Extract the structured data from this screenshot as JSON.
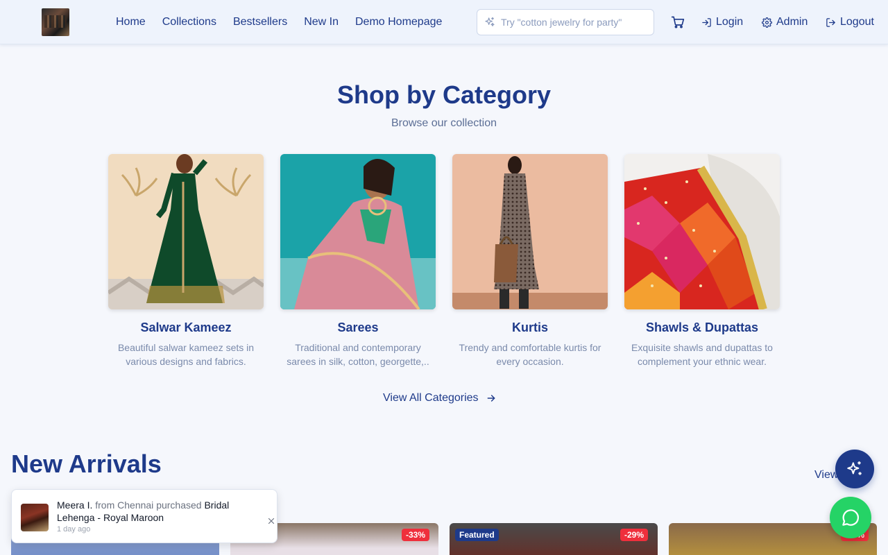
{
  "header": {
    "nav": [
      "Home",
      "Collections",
      "Bestsellers",
      "New In",
      "Demo Homepage"
    ],
    "search_placeholder": "Try \"cotton jewelry for party\"",
    "login": "Login",
    "admin": "Admin",
    "logout": "Logout"
  },
  "categories": {
    "title": "Shop by Category",
    "subtitle": "Browse our collection",
    "items": [
      {
        "name": "Salwar Kameez",
        "desc": "Beautiful salwar kameez sets in various designs and fabrics."
      },
      {
        "name": "Sarees",
        "desc": "Traditional and contemporary sarees in silk, cotton, georgette,.."
      },
      {
        "name": "Kurtis",
        "desc": "Trendy and comfortable kurtis for every occasion."
      },
      {
        "name": "Shawls & Dupattas",
        "desc": "Exquisite shawls and dupattas to complement your ethnic wear."
      }
    ],
    "view_all": "View All Categories"
  },
  "new_arrivals": {
    "title": "New Arrivals",
    "view_all": "View All",
    "badges": {
      "p2": "-33%",
      "p3_featured": "Featured",
      "p3": "-29%",
      "p4": "-43%"
    }
  },
  "toast": {
    "name": "Meera I.",
    "from": "from Chennai",
    "action": "purchased",
    "product": "Bridal Lehenga - Royal Maroon",
    "time": "1 day ago"
  },
  "colors": {
    "primary": "#1e3a8a",
    "discount": "#ef2f3c",
    "whatsapp": "#25d366"
  }
}
